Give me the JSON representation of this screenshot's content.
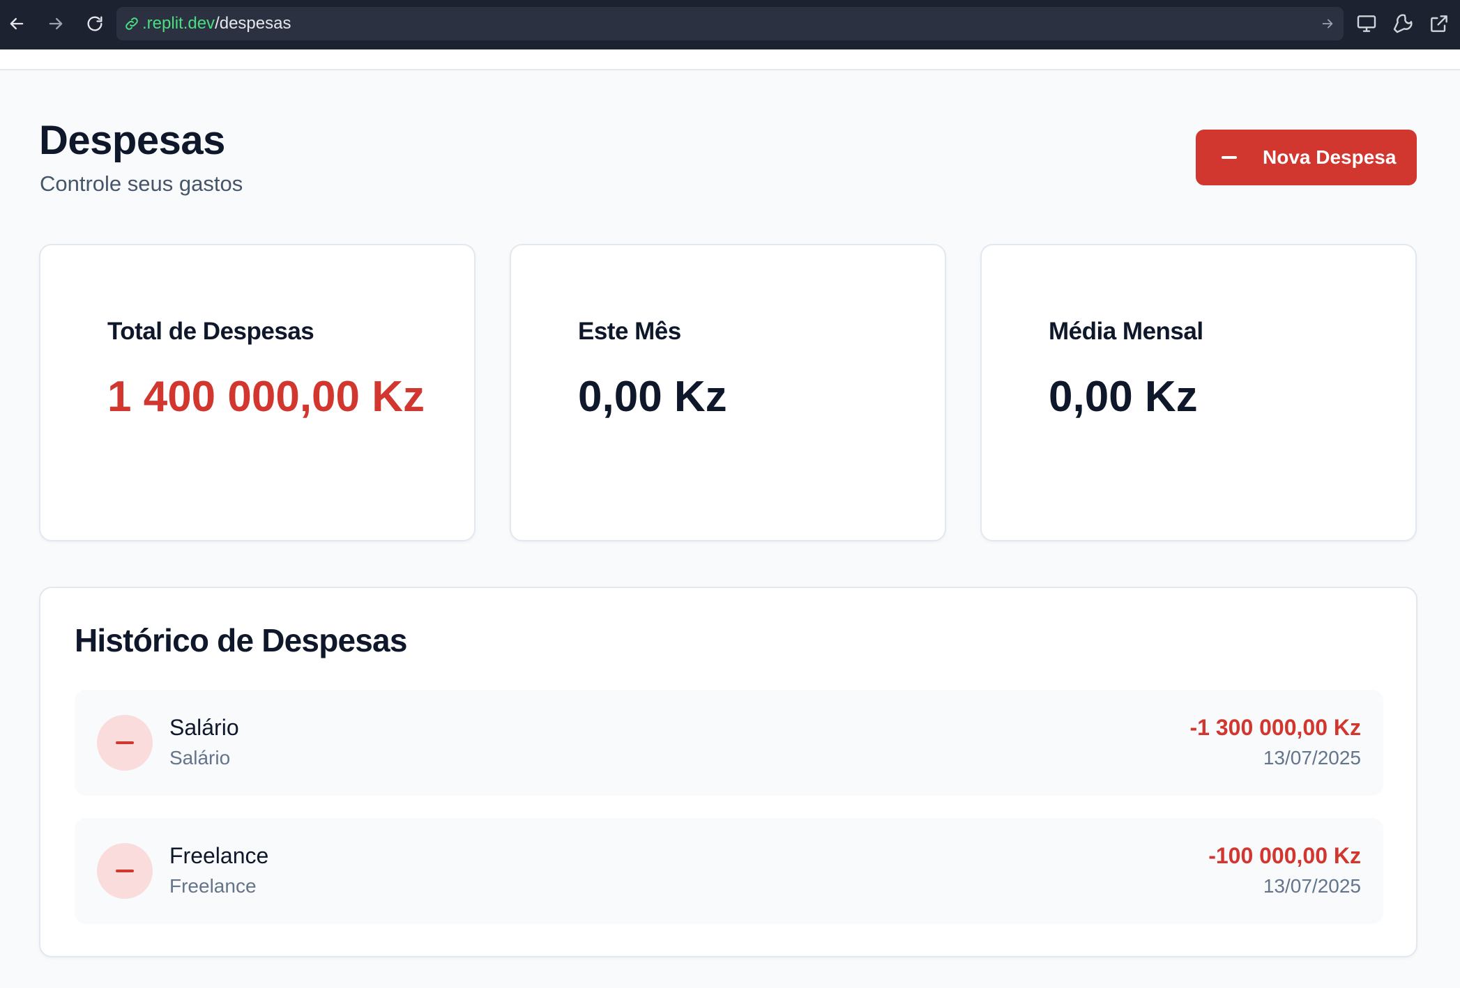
{
  "browser": {
    "url_domain": ".replit.dev",
    "url_path": "/despesas"
  },
  "header": {
    "title": "Despesas",
    "subtitle": "Controle seus gastos",
    "new_button_label": "Nova Despesa"
  },
  "stats": [
    {
      "label": "Total de Despesas",
      "value": "1 400 000,00 Kz",
      "negative": true
    },
    {
      "label": "Este Mês",
      "value": "0,00 Kz",
      "negative": false
    },
    {
      "label": "Média Mensal",
      "value": "0,00 Kz",
      "negative": false
    }
  ],
  "history": {
    "title": "Histórico de Despesas",
    "items": [
      {
        "name": "Salário",
        "category": "Salário",
        "amount": "-1 300 000,00 Kz",
        "date": "13/07/2025"
      },
      {
        "name": "Freelance",
        "category": "Freelance",
        "amount": "-100 000,00 Kz",
        "date": "13/07/2025"
      }
    ]
  },
  "colors": {
    "accent_red": "#d1362f",
    "icon_bg": "#fadcdc",
    "page_bg": "#f8fafc",
    "browser_bar": "#1c2230"
  },
  "icons": {
    "back": "arrow-left-icon",
    "forward": "arrow-right-icon",
    "reload": "reload-icon",
    "link": "link-icon",
    "go": "arrow-right-icon",
    "devices": "monitor-icon",
    "tools": "wrench-icon",
    "external": "external-link-icon",
    "expense": "minus-icon"
  }
}
